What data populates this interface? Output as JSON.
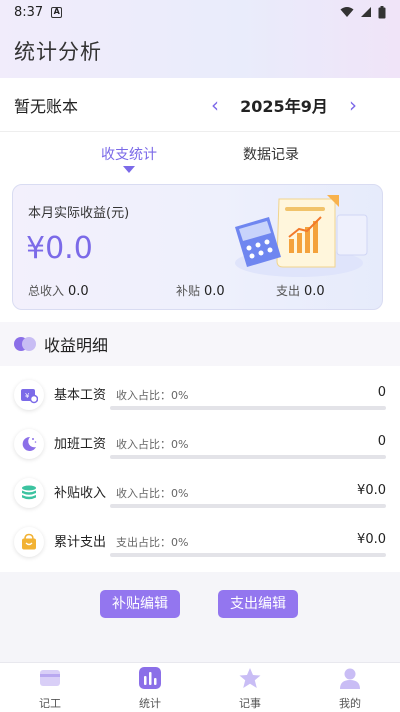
{
  "status_bar": {
    "time": "8:37",
    "notification_letter": "A"
  },
  "app": {
    "title": "统计分析"
  },
  "ledger": {
    "name": "暂无账本"
  },
  "month_nav": {
    "prev": "‹",
    "label": "2025年9月",
    "next": "›"
  },
  "tabs": [
    {
      "label": "收支统计",
      "active": true
    },
    {
      "label": "数据记录",
      "active": false
    }
  ],
  "summary": {
    "label": "本月实际收益(元)",
    "amount": "¥0.0",
    "totals": [
      {
        "label": "总收入",
        "value": "0.0"
      },
      {
        "label": "补贴",
        "value": "0.0"
      },
      {
        "label": "支出",
        "value": "0.0"
      }
    ]
  },
  "detail": {
    "title": "收益明细",
    "items": [
      {
        "icon": "wallet-icon",
        "name": "基本工资",
        "ratio": "收入占比：0%",
        "value": "0",
        "fraction": 0,
        "color": "#7b6ae8"
      },
      {
        "icon": "moon-icon",
        "name": "加班工资",
        "ratio": "收入占比：0%",
        "value": "0",
        "fraction": 0,
        "color": "#8b6fe8"
      },
      {
        "icon": "coins-icon",
        "name": "补贴收入",
        "ratio": "收入占比：0%",
        "value": "¥0.0",
        "fraction": 0,
        "color": "#3cc3a0"
      },
      {
        "icon": "shopping-bag-icon",
        "name": "累计支出",
        "ratio": "支出占比：0%",
        "value": "¥0.0",
        "fraction": 0,
        "color": "#f2b233"
      }
    ]
  },
  "actions": {
    "subsidy_edit": "补贴编辑",
    "expense_edit": "支出编辑"
  },
  "bottom_nav": [
    {
      "label": "记工",
      "icon": "card-icon",
      "active": false
    },
    {
      "label": "统计",
      "icon": "bar-chart-icon",
      "active": true
    },
    {
      "label": "记事",
      "icon": "star-icon",
      "active": false
    },
    {
      "label": "我的",
      "icon": "person-icon",
      "active": false
    }
  ],
  "colors": {
    "accent": "#7b6ae8",
    "button": "#9376ef"
  }
}
